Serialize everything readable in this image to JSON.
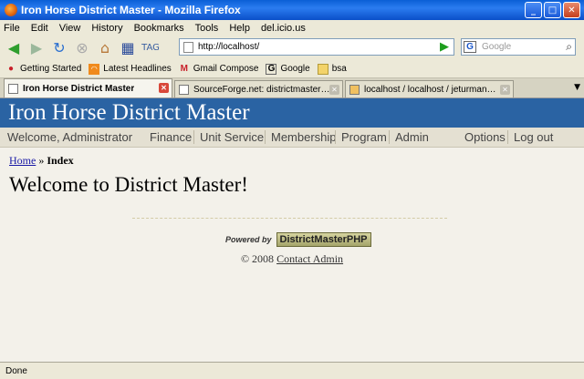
{
  "window": {
    "title": "Iron Horse District Master - Mozilla Firefox"
  },
  "menu": [
    "File",
    "Edit",
    "View",
    "History",
    "Bookmarks",
    "Tools",
    "Help",
    "del.icio.us"
  ],
  "toolbar": {
    "url": "http://localhost/",
    "search_placeholder": "Google"
  },
  "bookmarks": [
    "Getting Started",
    "Latest Headlines",
    "Gmail Compose",
    "Google",
    "bsa"
  ],
  "tabs": [
    {
      "label": "Iron Horse District Master",
      "active": true
    },
    {
      "label": "SourceForge.net: districtmaster Proje...",
      "active": false
    },
    {
      "label": "localhost / localhost / jeturman_distric...",
      "active": false
    }
  ],
  "site": {
    "title": "Iron Horse District Master",
    "welcome": "Welcome, Administrator",
    "nav": [
      "Finance",
      "Unit Service",
      "Membership",
      "Program",
      "Admin",
      "Options",
      "Log out"
    ],
    "breadcrumb": {
      "home": "Home",
      "separator": "»",
      "current": "Index"
    },
    "heading": "Welcome to District Master!",
    "powered_by": "Powered by",
    "badge": "DistrictMasterPHP",
    "footer_prefix": "© 2008",
    "footer_link": "Contact Admin"
  },
  "status": "Done"
}
